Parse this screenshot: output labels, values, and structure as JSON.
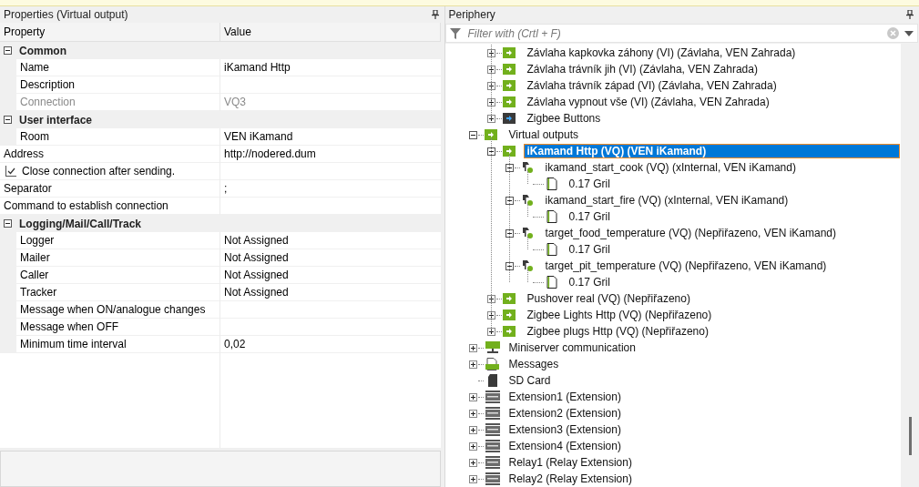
{
  "properties": {
    "title": "Properties (Virtual output)",
    "columns": [
      "Property",
      "Value"
    ],
    "rows": [
      {
        "kind": "category",
        "label": "Common",
        "expanded": true
      },
      {
        "kind": "child",
        "label": "Name",
        "value": "iKamand Http",
        "disabled": false
      },
      {
        "kind": "child",
        "label": "Description",
        "disabled": false
      },
      {
        "kind": "child",
        "label": "Connection",
        "value": "VQ3",
        "disabled": true
      },
      {
        "kind": "category",
        "label": "User interface",
        "expanded": true
      },
      {
        "kind": "child",
        "label": "Room",
        "value": "VEN iKamand",
        "disabled": false
      },
      {
        "kind": "root",
        "label": "Address",
        "value": "http://nodered.dum",
        "disabled": false
      },
      {
        "kind": "checkbox",
        "label": "Close connection after sending.",
        "checked": true
      },
      {
        "kind": "root",
        "label": "Separator",
        "value": ";",
        "disabled": false
      },
      {
        "kind": "root",
        "label": "Command to establish connection",
        "disabled": false
      },
      {
        "kind": "category",
        "label": "Logging/Mail/Call/Track",
        "expanded": true
      },
      {
        "kind": "child",
        "label": "Logger",
        "value": "Not Assigned",
        "disabled": false
      },
      {
        "kind": "child",
        "label": "Mailer",
        "value": "Not Assigned",
        "disabled": false
      },
      {
        "kind": "child",
        "label": "Caller",
        "value": "Not Assigned",
        "disabled": false
      },
      {
        "kind": "child",
        "label": "Tracker",
        "value": "Not Assigned",
        "disabled": false
      },
      {
        "kind": "child",
        "label": "Message when ON/analogue changes",
        "disabled": false
      },
      {
        "kind": "child",
        "label": "Message when OFF",
        "disabled": false
      },
      {
        "kind": "child",
        "label": "Minimum time interval",
        "value": "0,02",
        "disabled": false
      }
    ]
  },
  "periphery": {
    "title": "Periphery",
    "filter": {
      "placeholder": "Filter with (Crtl + F)"
    },
    "tree": [
      {
        "kind": "hidden",
        "children": [
          {
            "kind": "green-arrow",
            "label": "Závlaha kapkovka záhony (VI) (Závlaha, VEN Zahrada)",
            "expanded": false,
            "selected": false
          },
          {
            "kind": "green-arrow",
            "label": "Závlaha trávník jih (VI) (Závlaha, VEN Zahrada)",
            "expanded": false,
            "selected": false
          },
          {
            "kind": "green-arrow",
            "label": "Závlaha trávník západ (VI) (Závlaha, VEN Zahrada)",
            "expanded": false,
            "selected": false
          },
          {
            "kind": "green-arrow",
            "label": "Závlaha vypnout vše (VI) (Závlaha, VEN Zahrada)",
            "expanded": false,
            "selected": false
          },
          {
            "kind": "dark-arrow",
            "label": "Zigbee Buttons",
            "expanded": false,
            "selected": false
          }
        ]
      },
      {
        "kind": "green-arrow",
        "label": "Virtual outputs",
        "expanded": true,
        "selected": false,
        "children": [
          {
            "kind": "green-arrow",
            "label": "iKamand Http (VQ) (VEN iKamand)",
            "expanded": true,
            "selected": true,
            "children": [
              {
                "kind": "output",
                "label": "ikamand_start_cook (VQ) (xInternal, VEN iKamand)",
                "expanded": true,
                "selected": false,
                "children": [
                  {
                    "kind": "document",
                    "label": "0.17 Gril",
                    "selected": false
                  }
                ]
              },
              {
                "kind": "output",
                "label": "ikamand_start_fire (VQ) (xInternal, VEN iKamand)",
                "expanded": true,
                "selected": false,
                "children": [
                  {
                    "kind": "document",
                    "label": "0.17 Gril",
                    "selected": false
                  }
                ]
              },
              {
                "kind": "output",
                "label": "target_food_temperature (VQ) (Nepřiřazeno, VEN iKamand)",
                "expanded": true,
                "selected": false,
                "children": [
                  {
                    "kind": "document",
                    "label": "0.17 Gril",
                    "selected": false
                  }
                ]
              },
              {
                "kind": "output",
                "label": "target_pit_temperature (VQ) (Nepřiřazeno, VEN iKamand)",
                "expanded": true,
                "selected": false,
                "children": [
                  {
                    "kind": "document",
                    "label": "0.17 Gril",
                    "selected": false
                  }
                ]
              }
            ]
          },
          {
            "kind": "green-arrow",
            "label": "Pushover real (VQ) (Nepřiřazeno)",
            "expanded": false,
            "selected": false
          },
          {
            "kind": "green-arrow",
            "label": "Zigbee Lights Http (VQ) (Nepřiřazeno)",
            "expanded": false,
            "selected": false
          },
          {
            "kind": "green-arrow",
            "label": "Zigbee plugs Http (VQ) (Nepřiřazeno)",
            "expanded": false,
            "selected": false
          }
        ]
      },
      {
        "kind": "network",
        "label": "Miniserver communication",
        "expanded": false,
        "selected": false
      },
      {
        "kind": "log",
        "label": "Messages",
        "expanded": false,
        "selected": false
      },
      {
        "kind": "sdcard",
        "label": "SD Card",
        "selected": false
      },
      {
        "kind": "extension",
        "label": "Extension1 (Extension)",
        "expanded": false,
        "selected": false
      },
      {
        "kind": "extension",
        "label": "Extension2 (Extension)",
        "expanded": false,
        "selected": false
      },
      {
        "kind": "extension",
        "label": "Extension3 (Extension)",
        "expanded": false,
        "selected": false
      },
      {
        "kind": "extension",
        "label": "Extension4 (Extension)",
        "expanded": false,
        "selected": false
      },
      {
        "kind": "relay",
        "label": "Relay1 (Relay Extension)",
        "expanded": false,
        "selected": false
      },
      {
        "kind": "relay",
        "label": "Relay2 (Relay Extension)",
        "expanded": false,
        "selected": false
      }
    ]
  }
}
